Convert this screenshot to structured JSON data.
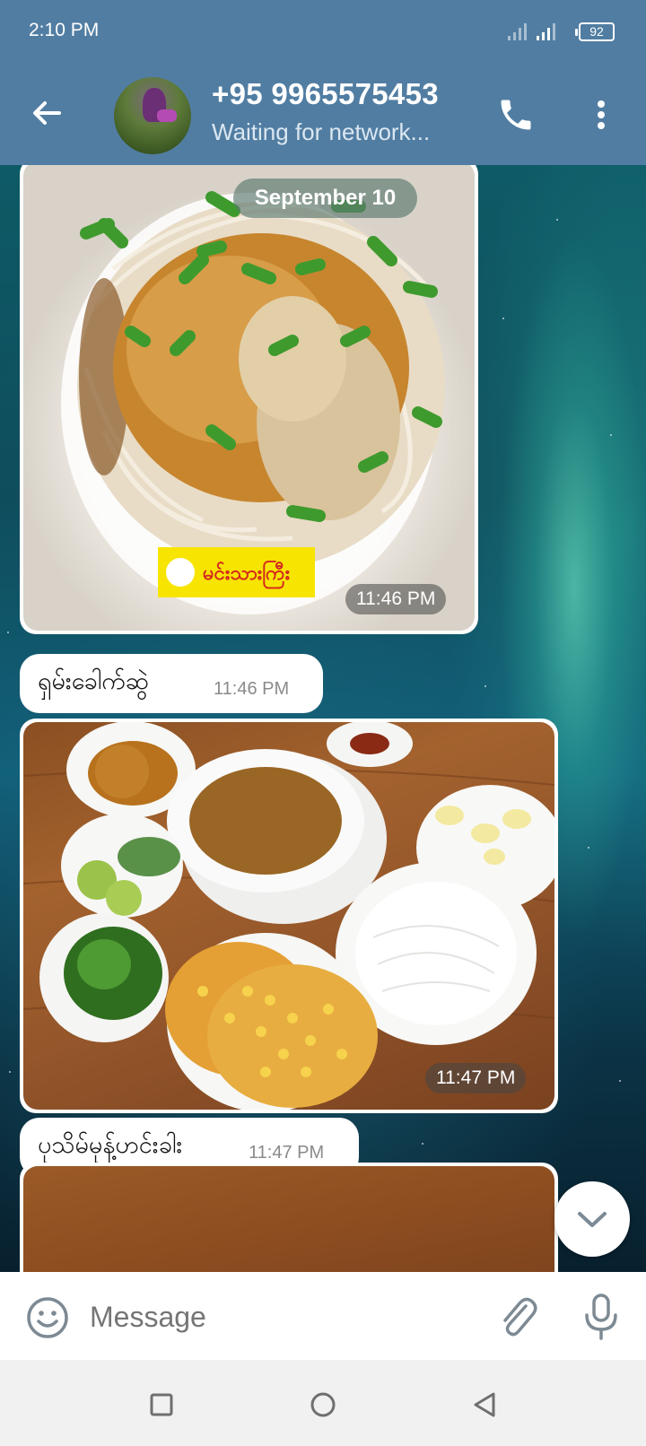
{
  "status_bar": {
    "time": "2:10 PM",
    "battery": "92"
  },
  "header": {
    "title": "+95 9965575453",
    "subtitle": "Waiting for network..."
  },
  "chat": {
    "date_chip": "September 10",
    "messages": [
      {
        "type": "photo",
        "time": "11:46 PM",
        "logo_text": "မင်းသားကြီး"
      },
      {
        "type": "text",
        "text": "ရှမ်းခေါက်ဆွဲ",
        "time": "11:46 PM"
      },
      {
        "type": "photo",
        "time": "11:47 PM"
      },
      {
        "type": "text",
        "text": "ပုသိမ်မုန့်ဟင်းခါး",
        "time": "11:47 PM"
      },
      {
        "type": "photo"
      }
    ]
  },
  "input": {
    "placeholder": "Message"
  },
  "icons": {
    "back": "arrow-left-icon",
    "call": "phone-icon",
    "more": "more-vert-icon",
    "emoji": "emoji-icon",
    "attach": "paperclip-icon",
    "mic": "microphone-icon",
    "scroll_down": "chevron-down-icon"
  },
  "colors": {
    "header": "#517da2",
    "bubble": "#ffffff",
    "timestamp": "#8a8a8a"
  }
}
